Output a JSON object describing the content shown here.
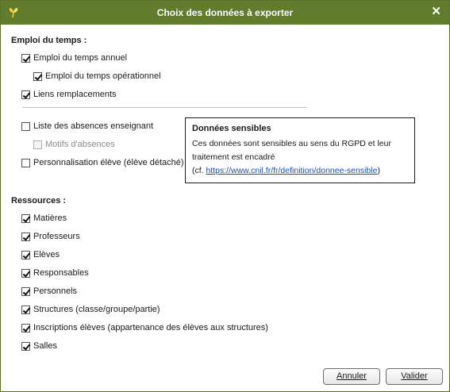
{
  "window": {
    "title": "Choix des données à exporter",
    "close_glyph": "✕"
  },
  "emploi": {
    "heading": "Emploi du temps :",
    "items": [
      {
        "label": "Emploi du temps annuel",
        "checked": true
      },
      {
        "label": "Emploi du temps opérationnel",
        "checked": true
      },
      {
        "label": "Liens remplacements",
        "checked": true
      }
    ]
  },
  "sensibles": {
    "items": [
      {
        "label": "Liste des absences enseignant",
        "checked": false
      },
      {
        "label": "Motifs d'absences",
        "checked": false,
        "disabled": true
      },
      {
        "label": "Personnalisation élève (élève détaché)",
        "checked": false
      }
    ]
  },
  "tooltip": {
    "title": "Données sensibles",
    "line1": "Ces données sont sensibles au sens du RGPD et leur",
    "line2": "traitement est encadré",
    "prefix": "(cf. ",
    "link": "https://www.cnil.fr/fr/definition/donnee-sensible",
    "suffix": ")"
  },
  "ressources": {
    "heading": "Ressources :",
    "items": [
      {
        "label": "Matières",
        "checked": true
      },
      {
        "label": "Professeurs",
        "checked": true
      },
      {
        "label": "Elèves",
        "checked": true
      },
      {
        "label": "Responsables",
        "checked": true
      },
      {
        "label": "Personnels",
        "checked": true
      },
      {
        "label": "Structures (classe/groupe/partie)",
        "checked": true
      },
      {
        "label": "Inscriptions élèves (appartenance des élèves aux structures)",
        "checked": true
      },
      {
        "label": "Salles",
        "checked": true
      }
    ]
  },
  "buttons": {
    "cancel": "Annuler",
    "ok": "Valider"
  },
  "colors": {
    "titlebar": "#607c2c",
    "link": "#1a4ea8"
  }
}
